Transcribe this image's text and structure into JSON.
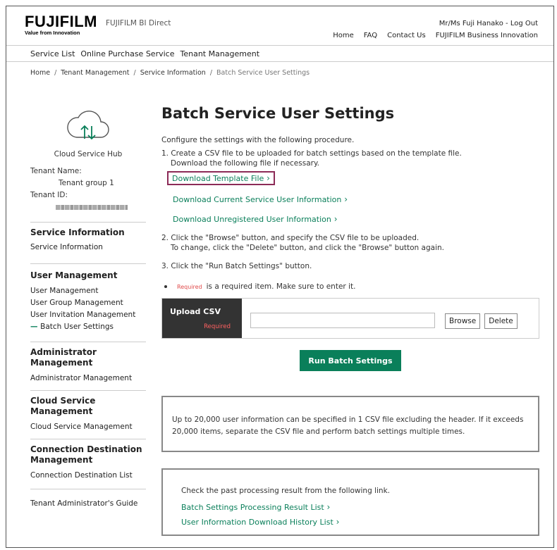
{
  "header": {
    "brand": "FUJIFILM",
    "tagline": "Value from Innovation",
    "sub_brand": "FUJIFILM BI Direct",
    "user_line": "Mr/Ms Fuji Hanako  -  Log Out",
    "nav": [
      "Home",
      "FAQ",
      "Contact Us",
      "FUJIFILM Business Innovation"
    ]
  },
  "menu": [
    "Service List",
    "Online Purchase Service",
    "Tenant Management"
  ],
  "breadcrumb": [
    "Home",
    "Tenant Management",
    "Service Information",
    "Batch Service User Settings"
  ],
  "sidebar": {
    "hub_label": "Cloud Service Hub",
    "tenant_name_label": "Tenant Name:",
    "tenant_name": "Tenant group 1",
    "tenant_id_label": "Tenant ID:",
    "sections": [
      {
        "title": "Service Information",
        "links": [
          "Service Information"
        ]
      },
      {
        "title": "User Management",
        "links": [
          "User Management",
          "User Group Management",
          "User Invitation Management",
          "Batch User Settings"
        ]
      },
      {
        "title": "Administrator Management",
        "links": [
          "Administrator Management"
        ]
      },
      {
        "title": "Cloud Service Management",
        "links": [
          "Cloud Service Management"
        ]
      },
      {
        "title": "Connection Destination Management",
        "links": [
          "Connection Destination List"
        ]
      }
    ],
    "guide": "Tenant Administrator's Guide"
  },
  "main": {
    "title": "Batch Service User Settings",
    "intro": "Configure the settings with the following procedure.",
    "step1_a": "1. Create a CSV file to be uploaded for batch settings based on the template file.",
    "step1_b": "Download the following file if necessary.",
    "link_template": "Download Template File",
    "link_current": "Download Current Service User Information",
    "link_unregistered": "Download Unregistered User Information",
    "step2_a": "2. Click the \"Browse\" button, and specify the CSV file to be uploaded.",
    "step2_b": "To change, click the \"Delete\" button, and click the \"Browse\" button again.",
    "step3": "3. Click the \"Run Batch Settings\" button.",
    "required_tag": "Required",
    "required_note": "is a required item. Make sure to enter it.",
    "upload_label": "Upload CSV",
    "upload_required": "Required",
    "upload_value": "",
    "browse": "Browse",
    "delete": "Delete",
    "run": "Run Batch Settings",
    "info1": "Up to 20,000 user information can be specified in 1 CSV file excluding the header. If it exceeds 20,000 items, separate the CSV file and perform batch settings multiple times.",
    "info2": "Check the past processing result from the following link.",
    "link_result": "Batch Settings Processing Result List",
    "link_history": "User Information Download History List"
  },
  "colors": {
    "accent": "#0a7f5a",
    "highlight": "#8c2b57",
    "required": "#e04a4a",
    "label_bg": "#333333"
  }
}
